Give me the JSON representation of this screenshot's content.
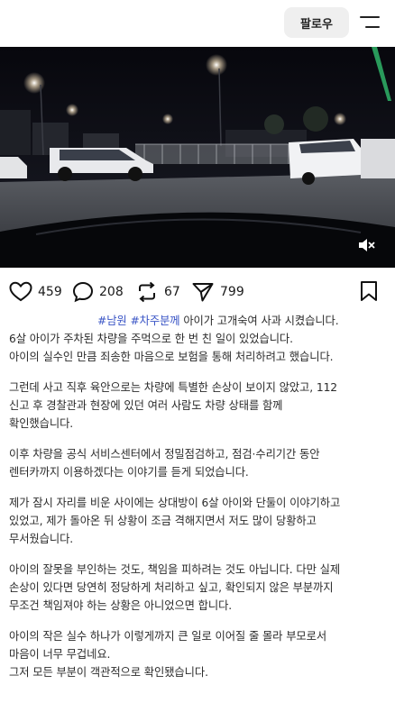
{
  "header": {
    "follow_label": "팔로우",
    "menu_icon": "menu-icon"
  },
  "media": {
    "type": "dashcam-video-still",
    "overlay_left": "",
    "overlay_center": "",
    "mute_icon": "mute-icon"
  },
  "actions": {
    "like": {
      "icon": "heart-icon",
      "count": "459"
    },
    "comment": {
      "icon": "comment-icon",
      "count": "208"
    },
    "repost": {
      "icon": "repost-icon",
      "count": "67"
    },
    "share": {
      "icon": "send-icon",
      "count": "799"
    },
    "bookmark": {
      "icon": "bookmark-icon"
    }
  },
  "post": {
    "hashtags": [
      "#남원",
      "#차주분께"
    ],
    "lines": [
      "아이가 고개숙여 사과 시켰습니다.",
      "6살 아이가 주차된 차량을 주먹으로 한 번 친 일이 있었습니다.",
      "아이의 실수인 만큼 죄송한 마음으로 보험을 통해 처리하려고 했습니다.",
      "그런데 사고 직후 육안으로는 차량에 특별한 손상이 보이지 않았고, 112",
      "신고 후 경찰관과 현장에 있던 여러 사람도 차량 상태를 함께",
      "확인했습니다.",
      "이후 차량을 공식 서비스센터에서 정밀점검하고, 점검·수리기간 동안",
      "렌터카까지 이용하겠다는 이야기를 듣게 되었습니다.",
      "제가 잠시 자리를 비운 사이에는 상대방이 6살 아이와 단둘이 이야기하고",
      "있었고, 제가 돌아온 뒤 상황이 조금 격해지면서 저도 많이 당황하고",
      "무서웠습니다.",
      "아이의 잘못을 부인하는 것도, 책임을 피하려는 것도 아닙니다. 다만 실제",
      "손상이 있다면 당연히 정당하게 처리하고 싶고, 확인되지 않은 부분까지",
      "무조건 책임져야 하는 상황은 아니었으면 합니다.",
      "아이의 작은 실수 하나가 이렇게까지 큰 일로 이어질 줄 몰라 부모로서",
      "마음이 너무 무겁네요.",
      "그저 모든 부분이 객관적으로 확인됐습니다."
    ]
  },
  "colors": {
    "hashtag": "#3a55c6",
    "follow_bg": "#efefef",
    "text": "#2b2b2b"
  }
}
